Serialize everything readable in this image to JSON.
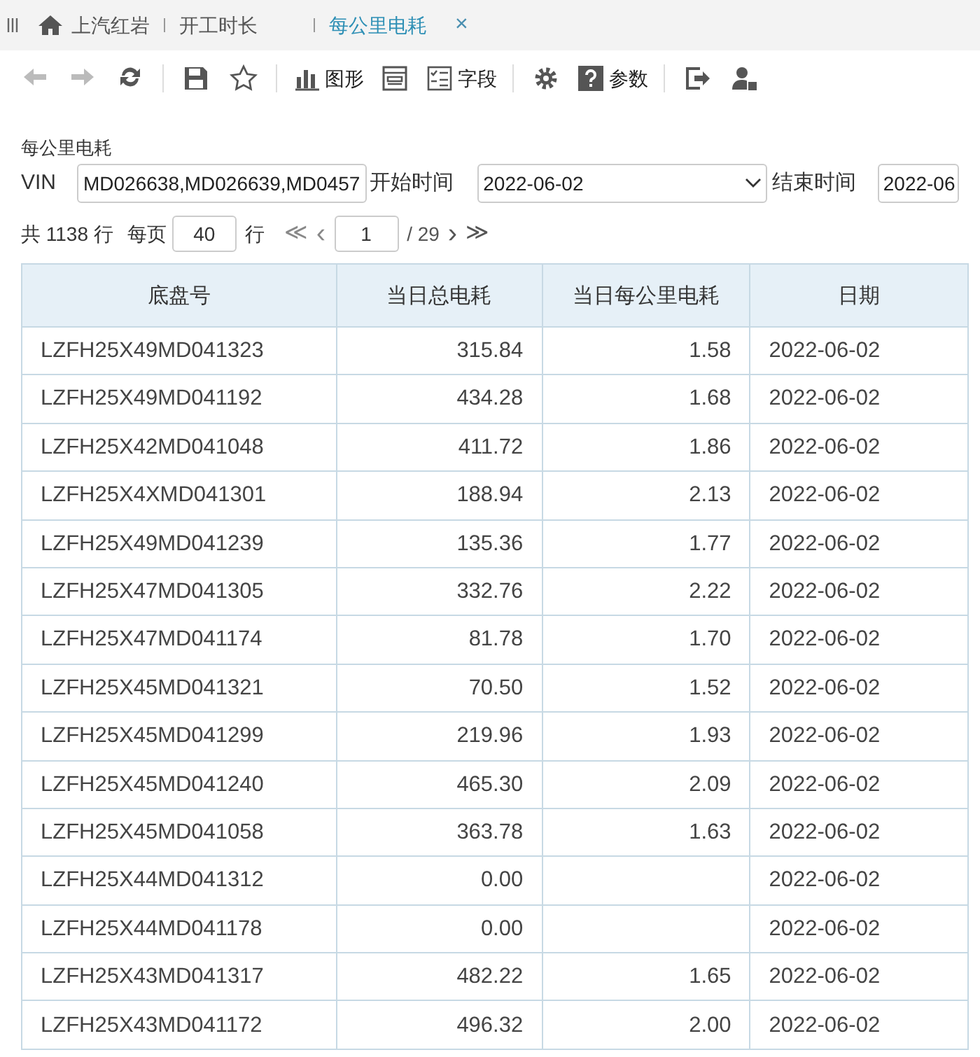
{
  "tabs": [
    {
      "label": "上汽红岩",
      "selected": false,
      "kind": "home"
    },
    {
      "label": "开工时长",
      "selected": false,
      "kind": "plain"
    },
    {
      "label": "每公里电耗",
      "selected": true,
      "kind": "closable",
      "close": "×"
    }
  ],
  "toolbar": [
    {
      "kind": "back",
      "disabled": true
    },
    {
      "kind": "forward",
      "disabled": true
    },
    {
      "kind": "refresh",
      "disabled": false
    },
    {
      "kind": "sep"
    },
    {
      "kind": "save",
      "disabled": false
    },
    {
      "kind": "star",
      "disabled": false
    },
    {
      "kind": "sep"
    },
    {
      "kind": "chart",
      "label": "图形",
      "disabled": false
    },
    {
      "kind": "layout",
      "disabled": false
    },
    {
      "kind": "fields",
      "label": "字段",
      "disabled": false
    },
    {
      "kind": "sep"
    },
    {
      "kind": "gear",
      "disabled": false
    },
    {
      "kind": "help",
      "label": "参数",
      "disabled": false
    },
    {
      "kind": "sep"
    },
    {
      "kind": "exit",
      "disabled": false
    },
    {
      "kind": "user",
      "disabled": false
    }
  ],
  "report_title": "每公里电耗",
  "filters": {
    "vin_label": "VIN",
    "vin_value": "MD026638,MD026639,MD0457",
    "start_label": "开始时间",
    "start_value": "2022-06-02",
    "end_label": "结束时间",
    "end_value": "2022-06"
  },
  "pagination": {
    "total": "共 1138 行",
    "per_page_label": "每页",
    "per_page": "40",
    "rows_unit": "行",
    "first": "≪",
    "prev": "‹",
    "page": "1",
    "of_pages": "/ 29",
    "next": "›",
    "last": "≫"
  },
  "table": {
    "columns": [
      "底盘号",
      "当日总电耗",
      "当日每公里电耗",
      "日期"
    ],
    "rows": [
      [
        "LZFH25X49MD041323",
        "315.84",
        "1.58",
        "2022-06-02"
      ],
      [
        "LZFH25X49MD041192",
        "434.28",
        "1.68",
        "2022-06-02"
      ],
      [
        "LZFH25X42MD041048",
        "411.72",
        "1.86",
        "2022-06-02"
      ],
      [
        "LZFH25X4XMD041301",
        "188.94",
        "2.13",
        "2022-06-02"
      ],
      [
        "LZFH25X49MD041239",
        "135.36",
        "1.77",
        "2022-06-02"
      ],
      [
        "LZFH25X47MD041305",
        "332.76",
        "2.22",
        "2022-06-02"
      ],
      [
        "LZFH25X47MD041174",
        "81.78",
        "1.70",
        "2022-06-02"
      ],
      [
        "LZFH25X45MD041321",
        "70.50",
        "1.52",
        "2022-06-02"
      ],
      [
        "LZFH25X45MD041299",
        "219.96",
        "1.93",
        "2022-06-02"
      ],
      [
        "LZFH25X45MD041240",
        "465.30",
        "2.09",
        "2022-06-02"
      ],
      [
        "LZFH25X45MD041058",
        "363.78",
        "1.63",
        "2022-06-02"
      ],
      [
        "LZFH25X44MD041312",
        "0.00",
        "",
        "2022-06-02"
      ],
      [
        "LZFH25X44MD041178",
        "0.00",
        "",
        "2022-06-02"
      ],
      [
        "LZFH25X43MD041317",
        "482.22",
        "1.65",
        "2022-06-02"
      ],
      [
        "LZFH25X43MD041172",
        "496.32",
        "2.00",
        "2022-06-02"
      ]
    ]
  }
}
